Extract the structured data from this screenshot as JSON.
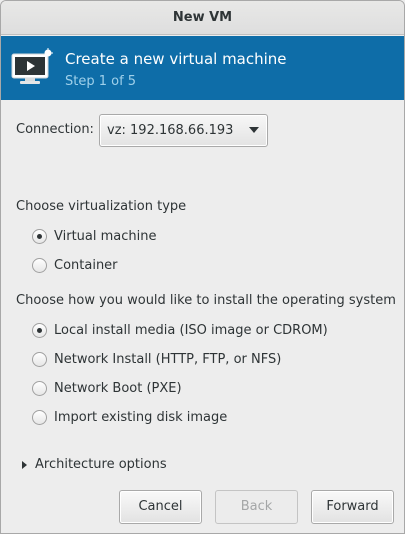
{
  "window": {
    "title": "New VM"
  },
  "banner": {
    "title": "Create a new virtual machine",
    "step": "Step 1 of 5",
    "icon": "monitor-play-icon"
  },
  "connection": {
    "label": "Connection:",
    "value": "vz: 192.168.66.193"
  },
  "virt_type": {
    "heading": "Choose virtualization type",
    "options": [
      {
        "label": "Virtual machine",
        "checked": true
      },
      {
        "label": "Container",
        "checked": false
      }
    ]
  },
  "install": {
    "heading": "Choose how you would like to install the operating system",
    "options": [
      {
        "label": "Local install media (ISO image or CDROM)",
        "checked": true
      },
      {
        "label": "Network Install (HTTP, FTP, or NFS)",
        "checked": false
      },
      {
        "label": "Network Boot (PXE)",
        "checked": false
      },
      {
        "label": "Import existing disk image",
        "checked": false
      }
    ]
  },
  "arch": {
    "label": "Architecture options"
  },
  "buttons": {
    "cancel": "Cancel",
    "back": "Back",
    "forward": "Forward"
  }
}
